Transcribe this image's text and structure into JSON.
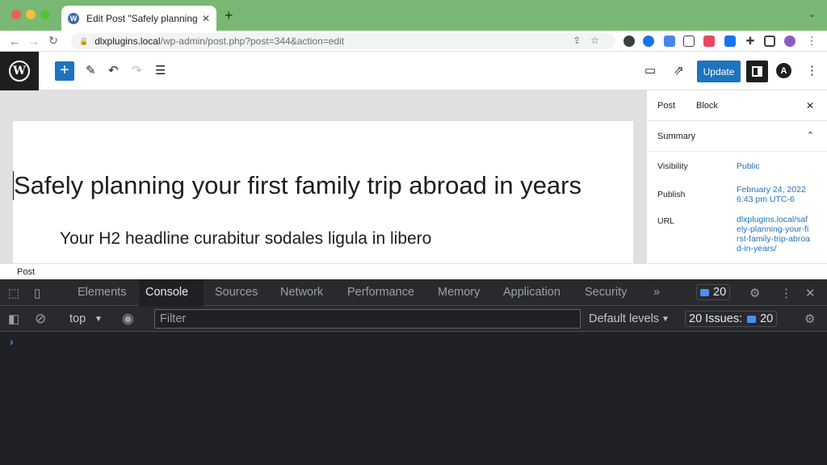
{
  "browser": {
    "tab_title": "Edit Post \"Safely planning your",
    "tab_close": "✕",
    "new_tab": "+",
    "tab_menu": "⌄",
    "url_host": "dlxplugins.local",
    "url_path": "/wp-admin/post.php?post=344&action=edit"
  },
  "wp": {
    "update_label": "Update",
    "post_title": "Safely planning your first family trip abroad in years",
    "h2_headline": "Your H2 headline curabitur sodales ligula in libero",
    "breadcrumb": "Post"
  },
  "sidebar": {
    "tabs": [
      "Post",
      "Block"
    ],
    "summary_label": "Summary",
    "rows": [
      {
        "label": "Visibility",
        "value": "Public"
      },
      {
        "label": "Publish",
        "value": "February 24, 2022 6:43 pm UTC-6"
      },
      {
        "label": "URL",
        "value": "dlxplugins.local/safely-planning-your-first-family-trip-abroad-in-years/"
      }
    ]
  },
  "devtools": {
    "tabs": [
      "Elements",
      "Console",
      "Sources",
      "Network",
      "Performance",
      "Memory",
      "Application",
      "Security"
    ],
    "active_tab": "Console",
    "more": "»",
    "issues_count": "20",
    "context": "top",
    "filter_placeholder": "Filter",
    "levels": "Default levels",
    "issues_label": "20 Issues:",
    "issues_badge": "20",
    "prompt": "›"
  },
  "colors": {
    "wp_blue": "#1e73be",
    "tabstrip_green": "#79b873",
    "devtools_bg": "#202124"
  }
}
